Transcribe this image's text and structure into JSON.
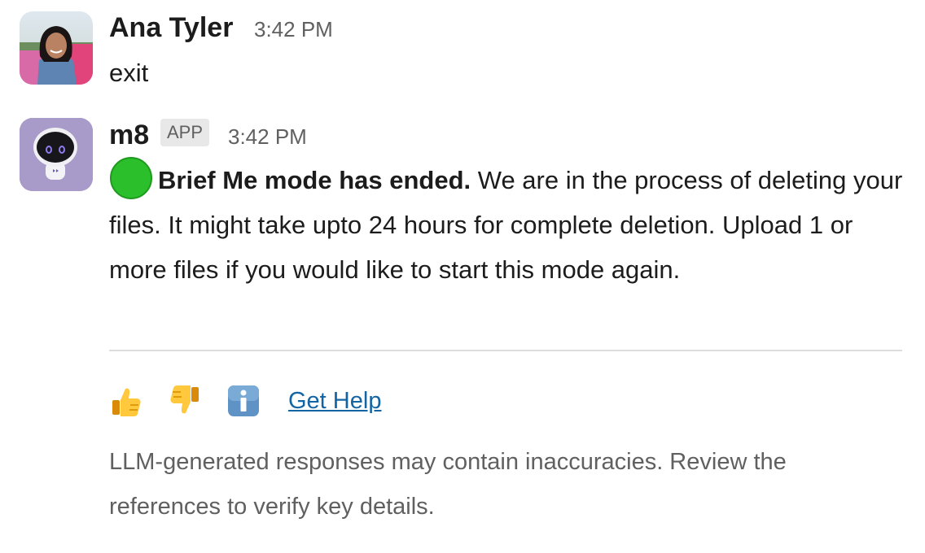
{
  "messages": [
    {
      "sender": "Ana Tyler",
      "time": "3:42 PM",
      "text": "exit"
    },
    {
      "sender": "m8",
      "badge": "APP",
      "time": "3:42 PM",
      "status_icon": "green-circle-icon",
      "bold_text": "Brief Me mode has ended.",
      "text": " We are in the process of deleting your files. It might take upto 24 hours for complete deletion. Upload 1 or more files if you would like to start this mode again."
    }
  ],
  "actions": {
    "thumbs_up_icon": "thumbs-up-icon",
    "thumbs_down_icon": "thumbs-down-icon",
    "info_icon": "info-icon",
    "help_link": "Get Help"
  },
  "disclaimer": "LLM-generated responses may contain inaccuracies. Review the references to verify key details.",
  "colors": {
    "text": "#1d1c1d",
    "muted": "#616061",
    "link": "#1264a3",
    "bot_avatar_bg": "#a89bc9",
    "status_green": "#2bbf2b"
  }
}
